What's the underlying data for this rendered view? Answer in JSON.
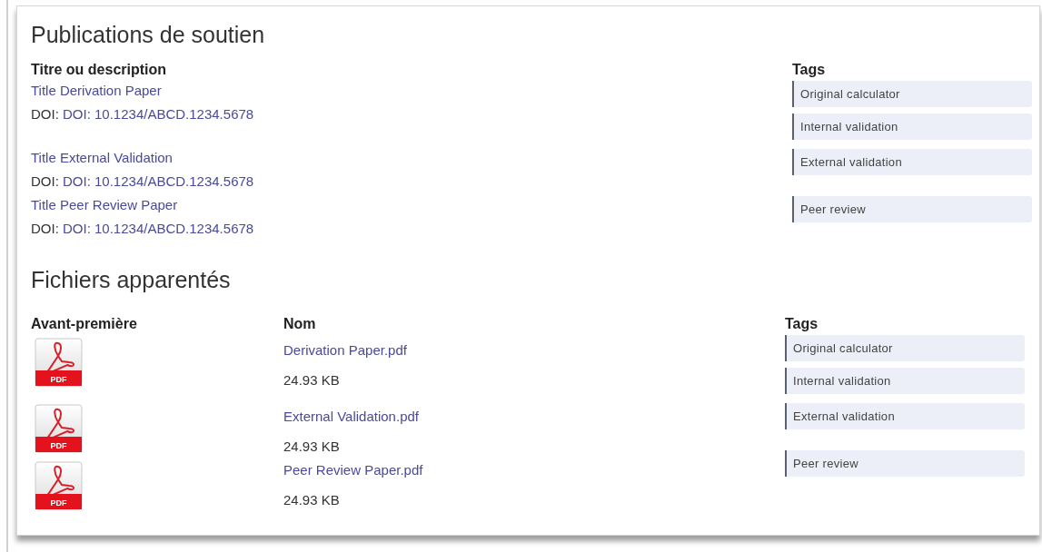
{
  "publications": {
    "title": "Publications de soutien",
    "columns": [
      "Titre ou description",
      "Tags"
    ],
    "items": [
      {
        "title": "Title Derivation Paper",
        "doi_label": "DOI:",
        "doi": "DOI: 10.1234/ABCD.1234.5678"
      },
      {
        "title": "Title External Validation",
        "doi_label": "DOI:",
        "doi": "DOI: 10.1234/ABCD.1234.5678"
      },
      {
        "title": "Title Peer Review Paper",
        "doi_label": "DOI:",
        "doi": "DOI: 10.1234/ABCD.1234.5678"
      }
    ],
    "tags": [
      "Original calculator",
      "Internal validation",
      "External validation",
      "Peer review"
    ]
  },
  "files": {
    "title": "Fichiers apparentés",
    "columns": [
      "Avant-première",
      "Nom",
      "Tags"
    ],
    "items": [
      {
        "icon_label": "PDF",
        "name": "Derivation Paper.pdf",
        "size": "24.93 KB"
      },
      {
        "icon_label": "PDF",
        "name": "External Validation.pdf",
        "size": "24.93 KB"
      },
      {
        "icon_label": "PDF",
        "name": "Peer Review Paper.pdf",
        "size": "24.93 KB"
      }
    ],
    "tags": [
      "Original calculator",
      "Internal validation",
      "External validation",
      "Peer review"
    ]
  }
}
